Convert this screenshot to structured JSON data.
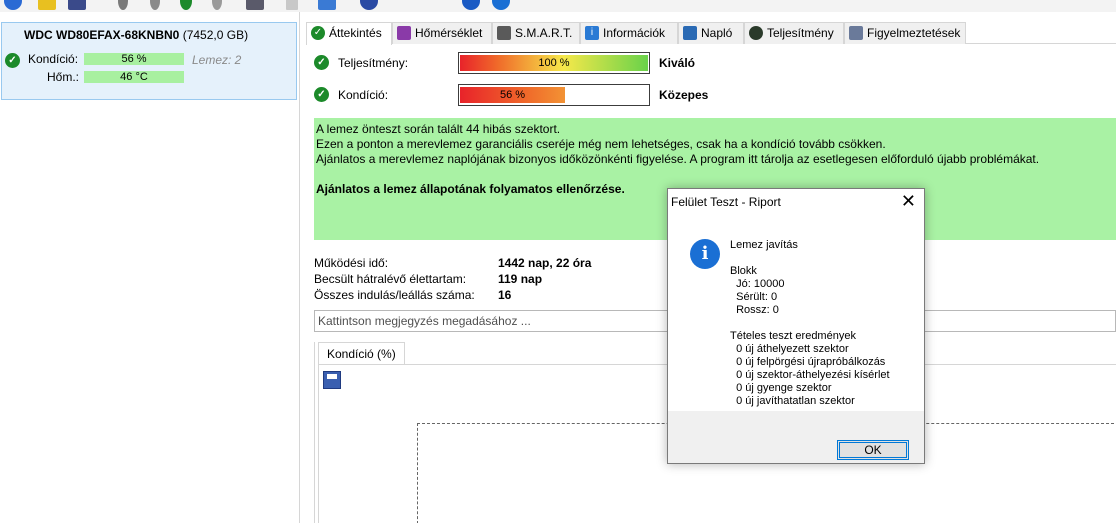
{
  "toolbar": {
    "icons": [
      "refresh-icon",
      "warning-icon",
      "disk-icon",
      "temperature-icon",
      "health-icon",
      "check-icon",
      "search-icon",
      "drive-icon",
      "document-icon",
      "export-icon",
      "settings-icon",
      "help-icon",
      "info-icon"
    ]
  },
  "disk": {
    "name": "WDC WD80EFAX-68KNBN0",
    "capacity": "(7452,0 GB)",
    "condition_label": "Kondíció:",
    "condition_value": "56 %",
    "disk_number": "Lemez: 2",
    "temp_label": "Hőm.:",
    "temp_value": "46 °C"
  },
  "tabs": [
    {
      "label": "Áttekintés",
      "icon": "check-icon",
      "color": "#1c8a2a"
    },
    {
      "label": "Hőmérséklet",
      "icon": "thermometer-icon",
      "color": "#8a3aa8"
    },
    {
      "label": "S.M.A.R.T.",
      "icon": "smart-icon",
      "color": "#5a5a5a"
    },
    {
      "label": "Információk",
      "icon": "info-icon",
      "color": "#2a7ad4"
    },
    {
      "label": "Napló",
      "icon": "log-icon",
      "color": "#2a6ab4"
    },
    {
      "label": "Teljesítmény",
      "icon": "performance-icon",
      "color": "#2a3a2a"
    },
    {
      "label": "Figyelmeztetések",
      "icon": "alerts-icon",
      "color": "#6a7a9a"
    }
  ],
  "overview": {
    "performance_label": "Teljesítmény:",
    "performance_value": "100 %",
    "performance_percent": 100,
    "performance_rating": "Kiváló",
    "health_label": "Kondíció:",
    "health_value": "56 %",
    "health_percent": 56,
    "health_rating": "Közepes",
    "messages": [
      "A lemez önteszt során talált 44 hibás szektort.",
      "Ezen a ponton a merevlemez garanciális cseréje még nem lehetséges, csak ha a kondíció tovább csökken.",
      "Ajánlatos a merevlemez naplójának bizonyos időközönkénti figyelése. A program itt tárolja az esetlegesen előforduló újabb problémákat."
    ],
    "recommendation": "Ajánlatos a lemez állapotának folyamatos ellenőrzése.",
    "stats": [
      {
        "label": "Működési idő:",
        "value": "1442 nap, 22 óra"
      },
      {
        "label": "Becsült hátralévő élettartam:",
        "value": "119 nap"
      },
      {
        "label": "Összes indulás/leállás száma:",
        "value": "16"
      }
    ],
    "note_placeholder": "Kattintson megjegyzés megadásához ...",
    "chart_tab": "Kondíció  (%)"
  },
  "dialog": {
    "title": "Felület Teszt - Riport",
    "close_symbol": "✕",
    "icon_glyph": "i",
    "body": "Lemez javítás\n\nBlokk\n  Jó: 10000\n  Sérült: 0\n  Rossz: 0\n\nTételes teszt eredmények\n  0 új áthelyezett szektor\n  0 új felpörgési újrapróbálkozás\n  0 új szektor-áthelyezési kísérlet\n  0 új gyenge szektor\n  0 új javíthatatlan szektor",
    "ok_label": "OK"
  }
}
